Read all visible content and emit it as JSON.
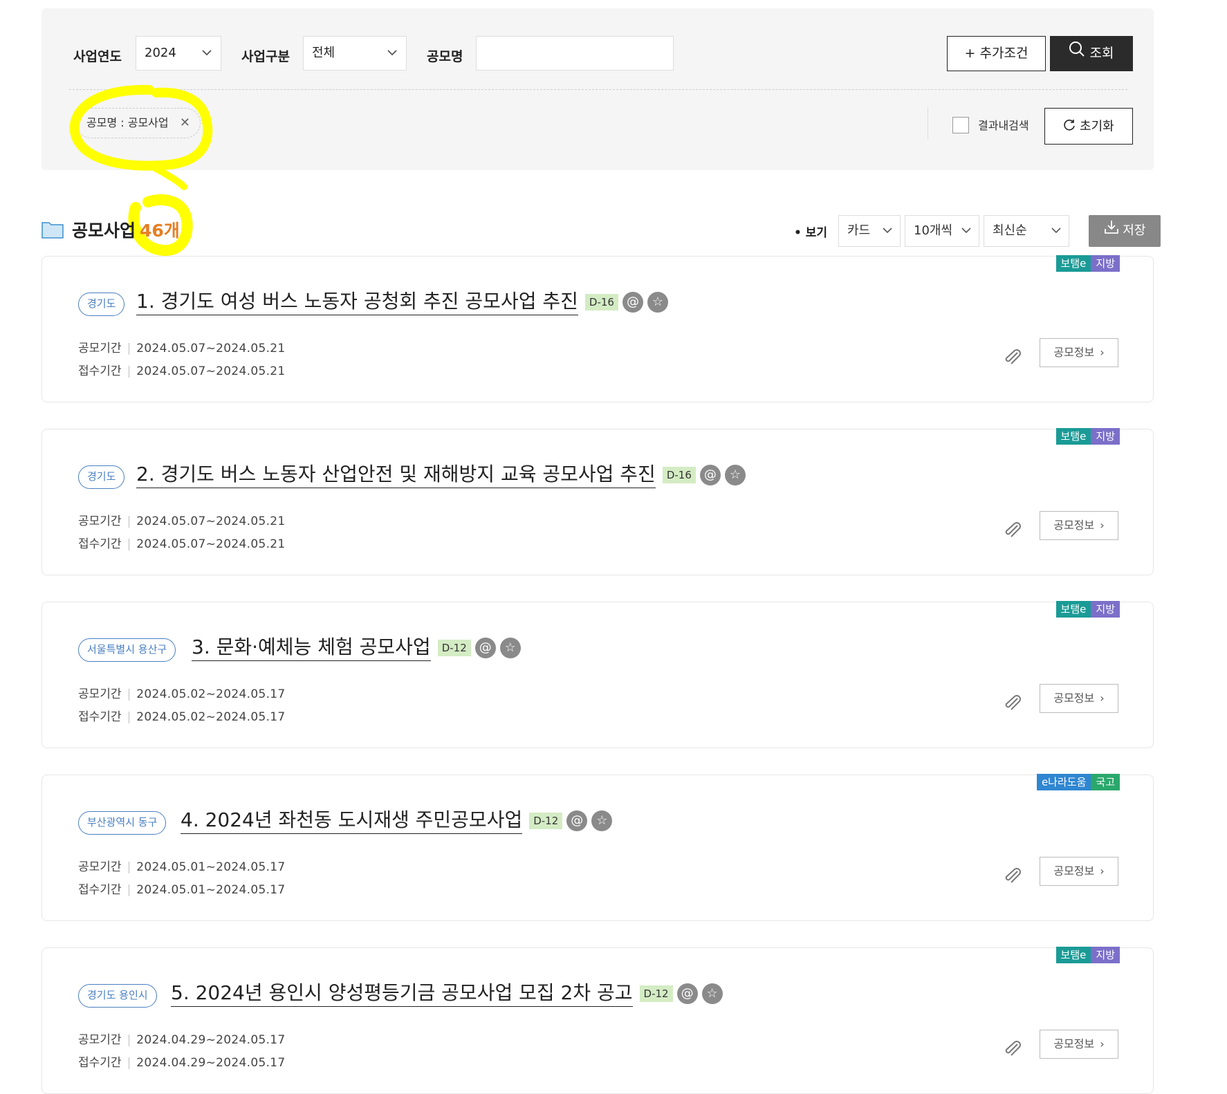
{
  "filters": {
    "year_label": "사업연도",
    "year_value": "2024",
    "type_label": "사업구분",
    "type_value": "전체",
    "name_label": "공모명",
    "name_value": "",
    "add_condition_label": "+ 추가조건",
    "search_label": "조회",
    "chip_text": "공모명 : 공모사업",
    "chip_close": "✕",
    "result_search_label": "결과내검색",
    "reset_label": "초기화"
  },
  "list": {
    "title": "공모사업",
    "count": "46개",
    "view_label": "• 보기",
    "view_value": "카드",
    "per_page_value": "10개씩",
    "sort_value": "최신순",
    "save_label": "저장"
  },
  "labels": {
    "period_label": "공모기간",
    "receipt_label": "접수기간",
    "info_button": "공모정보"
  },
  "colors": {
    "badge_teal": "#1a9b96",
    "badge_purple": "#7b6fc9",
    "badge_blue": "#2f86d1",
    "badge_green": "#2aa86c",
    "count_orange": "#e67e22",
    "highlight_yellow": "#ffff00"
  },
  "cards": [
    {
      "badge1": "보탬e",
      "badge2": "지방",
      "region": "경기도",
      "title": "1. 경기도 여성 버스 노동자 공청회 추진 공모사업 추진",
      "dday": "D-16",
      "period": "2024.05.07~2024.05.21",
      "receipt": "2024.05.07~2024.05.21"
    },
    {
      "badge1": "보탬e",
      "badge2": "지방",
      "region": "경기도",
      "title": "2. 경기도 버스 노동자 산업안전 및 재해방지 교육 공모사업 추진",
      "dday": "D-16",
      "period": "2024.05.07~2024.05.21",
      "receipt": "2024.05.07~2024.05.21"
    },
    {
      "badge1": "보탬e",
      "badge2": "지방",
      "region": "서울특별시 용산구",
      "title": "3. 문화·예체능 체험 공모사업",
      "dday": "D-12",
      "period": "2024.05.02~2024.05.17",
      "receipt": "2024.05.02~2024.05.17"
    },
    {
      "badge1": "e나라도움",
      "badge2": "국고",
      "region": "부산광역시 동구",
      "title": "4. 2024년 좌천동 도시재생 주민공모사업",
      "dday": "D-12",
      "period": "2024.05.01~2024.05.17",
      "receipt": "2024.05.01~2024.05.17"
    },
    {
      "badge1": "보탬e",
      "badge2": "지방",
      "region": "경기도 용인시",
      "title": "5. 2024년 용인시 양성평등기금 공모사업 모집 2차 공고",
      "dday": "D-12",
      "period": "2024.04.29~2024.05.17",
      "receipt": "2024.04.29~2024.05.17"
    }
  ]
}
